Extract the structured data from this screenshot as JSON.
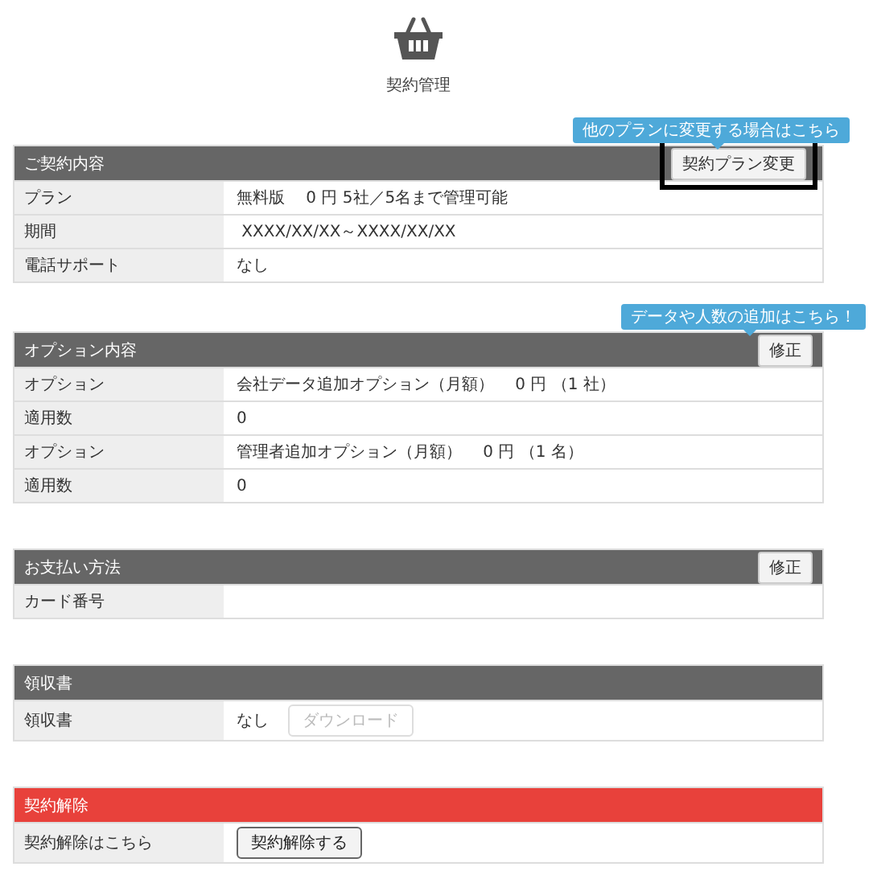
{
  "page_title": "契約管理",
  "sections": [
    {
      "title": "ご契約内容",
      "color": "#666666",
      "tooltip": "他のプランに変更する場合はこちら",
      "header_button": {
        "label": "契約プラン変更",
        "highlighted": true
      },
      "rows": [
        {
          "label": "プラン",
          "kind": "text",
          "value": "無料版　 0 円 5社／5名まで管理可能"
        },
        {
          "label": "期間",
          "kind": "text",
          "value": " XXXX/XX/XX～XXXX/XX/XX"
        },
        {
          "label": "電話サポート",
          "kind": "text",
          "value": "なし"
        }
      ]
    },
    {
      "title": "オプション内容",
      "color": "#666666",
      "tooltip": "データや人数の追加はこちら！",
      "header_button": {
        "label": "修正",
        "highlighted": false
      },
      "rows": [
        {
          "label": "オプション",
          "kind": "text",
          "value": "会社データ追加オプション（月額）　 0 円 （1 社）"
        },
        {
          "label": "適用数",
          "kind": "text",
          "value": "0"
        },
        {
          "label": "オプション",
          "kind": "text",
          "value": "管理者追加オプション（月額）　 0 円 （1 名）"
        },
        {
          "label": "適用数",
          "kind": "text",
          "value": "0"
        }
      ]
    },
    {
      "title": "お支払い方法",
      "color": "#666666",
      "header_button": {
        "label": "修正",
        "highlighted": false
      },
      "rows": [
        {
          "label": "カード番号",
          "kind": "empty"
        }
      ]
    },
    {
      "title": "領収書",
      "color": "#666666",
      "rows": [
        {
          "label": "領収書",
          "kind": "text_button",
          "value": "なし",
          "button": {
            "label": "ダウンロード",
            "disabled": true
          }
        }
      ]
    },
    {
      "title": "契約解除",
      "color": "#e8413b",
      "rows": [
        {
          "label": "契約解除はこちら",
          "kind": "button",
          "button": {
            "label": "契約解除する",
            "disabled": false
          }
        }
      ]
    }
  ]
}
